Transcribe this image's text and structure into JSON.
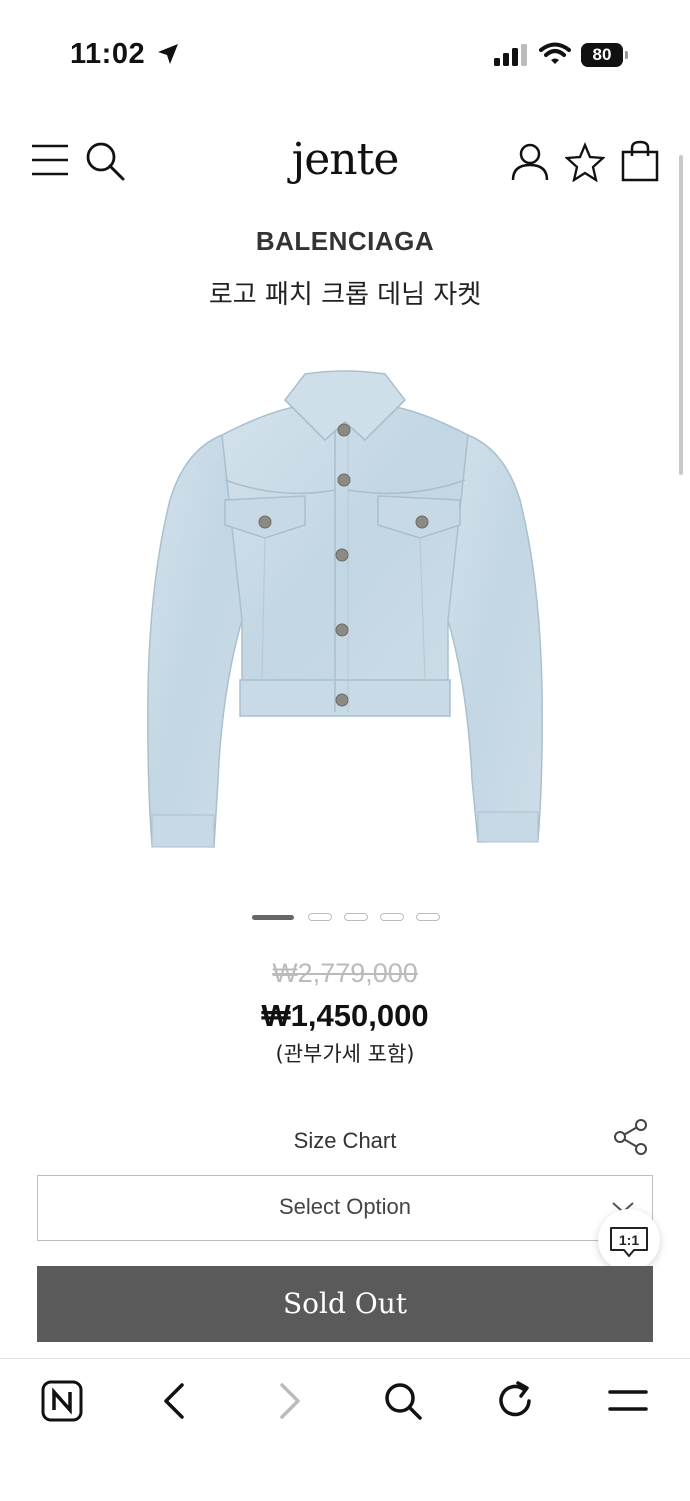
{
  "status_bar": {
    "time": "11:02",
    "battery": "80"
  },
  "header": {
    "logo": "jente"
  },
  "product": {
    "brand": "BALENCIAGA",
    "name": "로고 패치 크롭 데님 자켓",
    "original_price": "₩2,779,000",
    "sale_price": "₩1,450,000",
    "tax_note": "(관부가세 포함)",
    "image_count": 5,
    "active_image": 1
  },
  "options": {
    "size_chart_label": "Size Chart",
    "select_placeholder": "Select Option"
  },
  "chat_button": {
    "label": "1:1"
  },
  "buy_button": {
    "label": "Sold Out"
  },
  "colors": {
    "sold_out_bg": "#5a5a5a",
    "denim": "#c9dbe6"
  },
  "icons": [
    "location-arrow-icon",
    "signal-icon",
    "wifi-icon",
    "battery-icon",
    "menu-icon",
    "search-icon",
    "user-icon",
    "star-icon",
    "bag-icon",
    "share-icon",
    "chevron-down-icon",
    "chat-icon",
    "naver-icon",
    "back-icon",
    "forward-icon",
    "browser-search-icon",
    "reload-icon",
    "browser-menu-icon"
  ]
}
